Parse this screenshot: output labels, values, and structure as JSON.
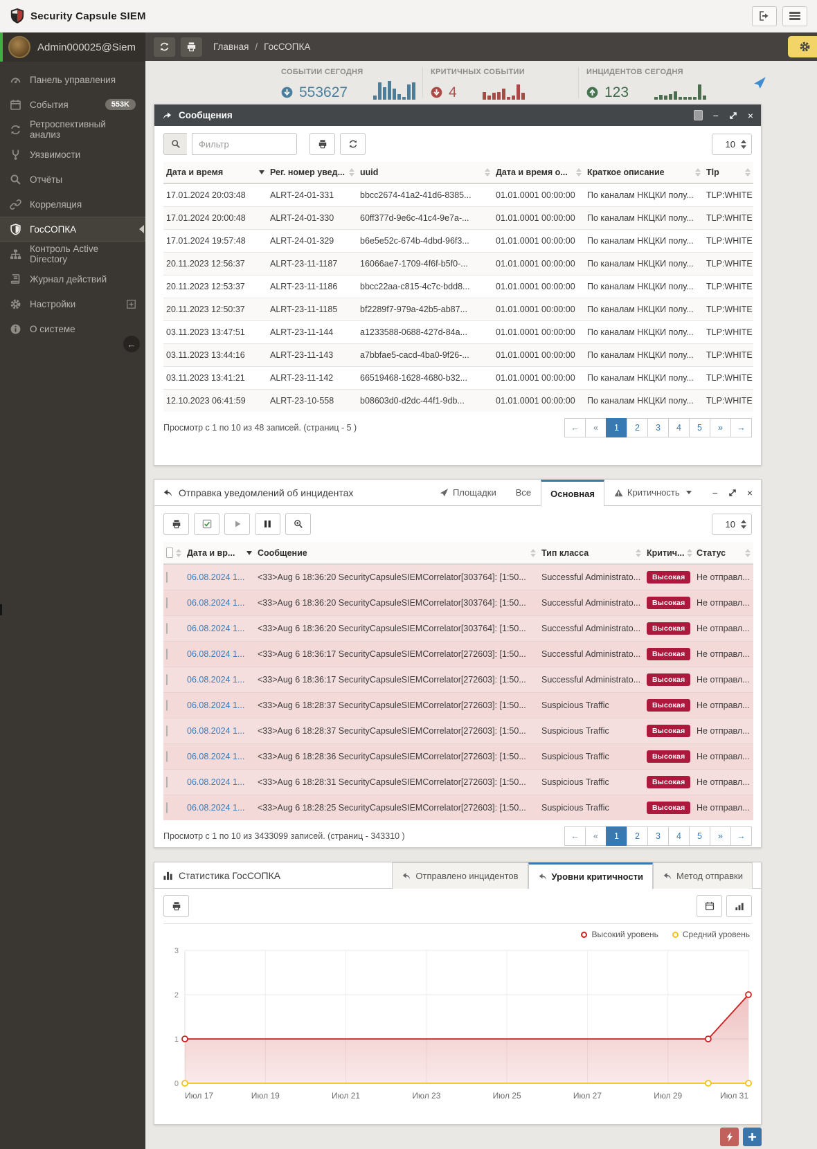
{
  "app": {
    "title": "Security Capsule SIEM"
  },
  "sidebar": {
    "user": "Admin000025@Siem",
    "items": [
      {
        "label": "Панель управления"
      },
      {
        "label": "События",
        "badge": "553K"
      },
      {
        "label": "Ретроспективный анализ"
      },
      {
        "label": "Уязвимости"
      },
      {
        "label": "Отчёты"
      },
      {
        "label": "Корреляция"
      },
      {
        "label": "ГосСОПКА",
        "active": true
      },
      {
        "label": "Контроль Active Directory"
      },
      {
        "label": "Журнал действий"
      },
      {
        "label": "Настройки",
        "expandable": true
      },
      {
        "label": "О системе"
      }
    ]
  },
  "breadcrumb": {
    "home": "Главная",
    "sep": "/",
    "current": "ГосСОПКА"
  },
  "stats": {
    "events": {
      "label": "СОБЫТИИ СЕГОДНЯ",
      "value": "553627"
    },
    "critical": {
      "label": "КРИТИЧНЫХ СОБЫТИИ",
      "value": "4"
    },
    "incidents": {
      "label": "ИНЦИДЕНТОВ СЕГОДНЯ",
      "value": "123"
    }
  },
  "ui": {
    "minimize_glyph": "−",
    "close_glyph": "×",
    "collapse_glyph": "←",
    "pager": {
      "first": "←",
      "prev": "«",
      "pages": [
        "1",
        "2",
        "3",
        "4",
        "5"
      ],
      "active_page": "1",
      "next": "»",
      "last": "→"
    }
  },
  "colors": {
    "accent_blue": "#3779b0",
    "stat_blue": "#4a7e9b",
    "stat_red": "#ac5450",
    "stat_green": "#41694a",
    "severity_badge": "#ab1a3d",
    "row_pink": "#f5dfde",
    "gear_button": "#f2d469"
  },
  "messages": {
    "title": "Сообщения",
    "filter_placeholder": "Фильтр",
    "page_size": "10",
    "columns": [
      "Дата и время",
      "Рег. номер увед...",
      "uuid",
      "Дата и время о...",
      "Краткое описание",
      "Tlp"
    ],
    "rows": [
      [
        "17.01.2024 20:03:48",
        "ALRT-24-01-331",
        "bbcc2674-41a2-41d6-8385...",
        "01.01.0001 00:00:00",
        "По каналам НКЦКИ полу...",
        "TLP:WHITE"
      ],
      [
        "17.01.2024 20:00:48",
        "ALRT-24-01-330",
        "60ff377d-9e6c-41c4-9e7a-...",
        "01.01.0001 00:00:00",
        "По каналам НКЦКИ полу...",
        "TLP:WHITE"
      ],
      [
        "17.01.2024 19:57:48",
        "ALRT-24-01-329",
        "b6e5e52c-674b-4dbd-96f3...",
        "01.01.0001 00:00:00",
        "По каналам НКЦКИ полу...",
        "TLP:WHITE"
      ],
      [
        "20.11.2023 12:56:37",
        "ALRT-23-11-1187",
        "16066ae7-1709-4f6f-b5f0-...",
        "01.01.0001 00:00:00",
        "По каналам НКЦКИ полу...",
        "TLP:WHITE"
      ],
      [
        "20.11.2023 12:53:37",
        "ALRT-23-11-1186",
        "bbcc22aa-c815-4c7c-bdd8...",
        "01.01.0001 00:00:00",
        "По каналам НКЦКИ полу...",
        "TLP:WHITE"
      ],
      [
        "20.11.2023 12:50:37",
        "ALRT-23-11-1185",
        "bf2289f7-979a-42b5-ab87...",
        "01.01.0001 00:00:00",
        "По каналам НКЦКИ полу...",
        "TLP:WHITE"
      ],
      [
        "03.11.2023 13:47:51",
        "ALRT-23-11-144",
        "a1233588-0688-427d-84a...",
        "01.01.0001 00:00:00",
        "По каналам НКЦКИ полу...",
        "TLP:WHITE"
      ],
      [
        "03.11.2023 13:44:16",
        "ALRT-23-11-143",
        "a7bbfae5-cacd-4ba0-9f26-...",
        "01.01.0001 00:00:00",
        "По каналам НКЦКИ полу...",
        "TLP:WHITE"
      ],
      [
        "03.11.2023 13:41:21",
        "ALRT-23-11-142",
        "66519468-1628-4680-b32...",
        "01.01.0001 00:00:00",
        "По каналам НКЦКИ полу...",
        "TLP:WHITE"
      ],
      [
        "12.10.2023 06:41:59",
        "ALRT-23-10-558",
        "b08603d0-d2dc-44f1-9db...",
        "01.01.0001 00:00:00",
        "По каналам НКЦКИ полу...",
        "TLP:WHITE"
      ]
    ],
    "footer": "Просмотр с 1 по 10 из 48 записей. (страниц - 5 )"
  },
  "incidents": {
    "title": "Отправка уведомлений об инцидентах",
    "tabs": {
      "sites": "Площадки",
      "all": "Все",
      "main": "Основная",
      "severity": "Критичность"
    },
    "page_size": "10",
    "columns": [
      "Дата и вр...",
      "Сообщение",
      "Тип класса",
      "Критич...",
      "Статус"
    ],
    "rows": [
      {
        "date": "06.08.2024 1...",
        "message": "<33>Aug 6 18:36:20 SecurityCapsuleSIEMCorrelator[303764]: [1:50...",
        "class_type": "Successful Administrato...",
        "severity": "Высокая",
        "status": "Не отправл..."
      },
      {
        "date": "06.08.2024 1...",
        "message": "<33>Aug 6 18:36:20 SecurityCapsuleSIEMCorrelator[303764]: [1:50...",
        "class_type": "Successful Administrato...",
        "severity": "Высокая",
        "status": "Не отправл..."
      },
      {
        "date": "06.08.2024 1...",
        "message": "<33>Aug 6 18:36:20 SecurityCapsuleSIEMCorrelator[303764]: [1:50...",
        "class_type": "Successful Administrato...",
        "severity": "Высокая",
        "status": "Не отправл..."
      },
      {
        "date": "06.08.2024 1...",
        "message": "<33>Aug 6 18:36:17 SecurityCapsuleSIEMCorrelator[272603]: [1:50...",
        "class_type": "Successful Administrato...",
        "severity": "Высокая",
        "status": "Не отправл..."
      },
      {
        "date": "06.08.2024 1...",
        "message": "<33>Aug 6 18:36:17 SecurityCapsuleSIEMCorrelator[272603]: [1:50...",
        "class_type": "Successful Administrato...",
        "severity": "Высокая",
        "status": "Не отправл..."
      },
      {
        "date": "06.08.2024 1...",
        "message": "<33>Aug 6 18:28:37 SecurityCapsuleSIEMCorrelator[272603]: [1:50...",
        "class_type": "Suspicious Traffic",
        "severity": "Высокая",
        "status": "Не отправл..."
      },
      {
        "date": "06.08.2024 1...",
        "message": "<33>Aug 6 18:28:37 SecurityCapsuleSIEMCorrelator[272603]: [1:50...",
        "class_type": "Suspicious Traffic",
        "severity": "Высокая",
        "status": "Не отправл..."
      },
      {
        "date": "06.08.2024 1...",
        "message": "<33>Aug 6 18:28:36 SecurityCapsuleSIEMCorrelator[272603]: [1:50...",
        "class_type": "Suspicious Traffic",
        "severity": "Высокая",
        "status": "Не отправл..."
      },
      {
        "date": "06.08.2024 1...",
        "message": "<33>Aug 6 18:28:31 SecurityCapsuleSIEMCorrelator[272603]: [1:50...",
        "class_type": "Suspicious Traffic",
        "severity": "Высокая",
        "status": "Не отправл..."
      },
      {
        "date": "06.08.2024 1...",
        "message": "<33>Aug 6 18:28:25 SecurityCapsuleSIEMCorrelator[272603]: [1:50...",
        "class_type": "Suspicious Traffic",
        "severity": "Высокая",
        "status": "Не отправл..."
      }
    ],
    "footer": "Просмотр с 1 по 10 из 3433099 записей. (страниц - 343310 )"
  },
  "statistics": {
    "title": "Статистика ГосСОПКА",
    "tabs": [
      "Отправлено инцидентов",
      "Уровни критичности",
      "Метод отправки"
    ],
    "active_tab": "Уровни критичности"
  },
  "chart_data": [
    {
      "type": "line",
      "title": "Уровни критичности",
      "x_labels": [
        "Июл 17",
        "Июл 19",
        "Июл 21",
        "Июл 23",
        "Июл 25",
        "Июл 27",
        "Июл 29",
        "Июл 31"
      ],
      "y_ticks": [
        "0",
        "1",
        "2",
        "3"
      ],
      "ylim": [
        0,
        3
      ],
      "days": 14,
      "grid": true,
      "legend_position": "top-right",
      "series": [
        {
          "name": "Высокий уровень",
          "color": "#cc2020",
          "points": [
            [
              0,
              1
            ],
            [
              13,
              1
            ],
            [
              14,
              2
            ]
          ]
        },
        {
          "name": "Средний уровень",
          "color": "#f2c218",
          "points": [
            [
              0,
              0
            ],
            [
              13,
              0
            ],
            [
              14,
              0
            ]
          ]
        }
      ]
    },
    {
      "type": "bar",
      "name": "events-sparkline",
      "color": "#4e7e97",
      "values": [
        2,
        16,
        11,
        18,
        10,
        4,
        1,
        14,
        16
      ]
    },
    {
      "type": "bar",
      "name": "critical-sparkline",
      "color": "#a84b47",
      "values": [
        6,
        2,
        5,
        6,
        10,
        1,
        2,
        14,
        5
      ]
    },
    {
      "type": "bar",
      "name": "incidents-sparkline",
      "color": "#4c6e4f",
      "values": [
        1,
        3,
        2,
        4,
        7,
        1,
        1,
        1,
        1,
        14,
        2
      ]
    }
  ]
}
